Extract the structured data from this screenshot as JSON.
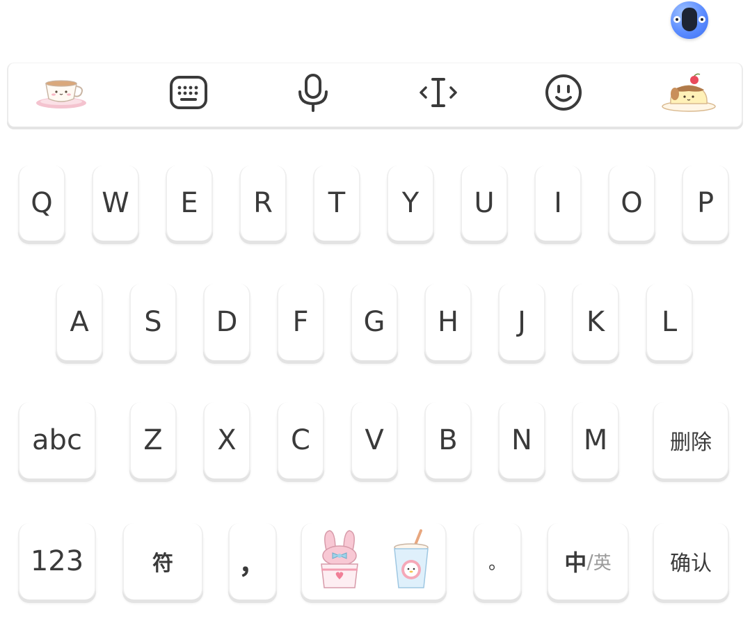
{
  "toolbar": {
    "items": [
      {
        "icon": "teacup-sticker-icon"
      },
      {
        "icon": "keyboard-icon"
      },
      {
        "icon": "microphone-icon"
      },
      {
        "icon": "cursor-move-icon"
      },
      {
        "icon": "smiley-icon"
      },
      {
        "icon": "pudding-sticker-icon"
      }
    ]
  },
  "keyboard": {
    "row1": [
      "Q",
      "W",
      "E",
      "R",
      "T",
      "Y",
      "U",
      "I",
      "O",
      "P"
    ],
    "row2": [
      "A",
      "S",
      "D",
      "F",
      "G",
      "H",
      "J",
      "K",
      "L"
    ],
    "row3": {
      "case_key": "abc",
      "letters": [
        "Z",
        "X",
        "C",
        "V",
        "B",
        "N",
        "M"
      ],
      "delete_key": "删除"
    },
    "row4": {
      "numbers_key": "123",
      "symbols_key": "符",
      "comma_key": "，",
      "space_icons": [
        "bunny-cup-sticker-icon",
        "drink-cup-sticker-icon"
      ],
      "period_key": "。",
      "lang_main": "中",
      "lang_sep": "/",
      "lang_alt": "英",
      "confirm_key": "确认"
    }
  }
}
